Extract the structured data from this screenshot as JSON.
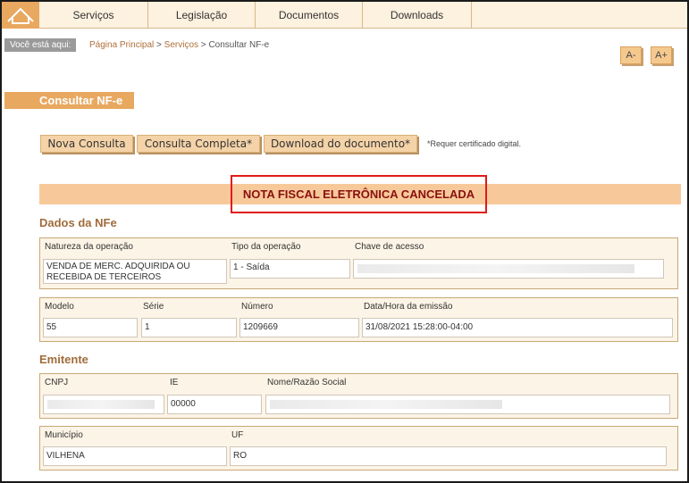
{
  "nav": {
    "items": [
      "Serviços",
      "Legislação",
      "Documentos",
      "Downloads"
    ]
  },
  "breadcrumb": {
    "label": "Você está aqui:",
    "home": "Página Principal",
    "sep1": " > ",
    "services": "Serviços",
    "sep2": " > ",
    "current": "Consultar NF-e"
  },
  "font_controls": {
    "decrease": "A-",
    "increase": "A+"
  },
  "page_title": "Consultar NF-e",
  "actions": {
    "new_query": "Nova Consulta",
    "full_query": "Consulta Completa*",
    "download": "Download do documento*",
    "cert_note": "*Requer certificado digital."
  },
  "status": "NOTA FISCAL ELETRÔNICA CANCELADA",
  "nfe": {
    "section_title": "Dados da NFe",
    "operation_label": "Natureza da operação",
    "operation_value": "VENDA DE MERC. ADQUIRIDA OU RECEBIDA DE TERCEIROS",
    "type_label": "Tipo da operação",
    "type_value": "1 - Saída",
    "key_label": "Chave de acesso",
    "model_label": "Modelo",
    "model_value": "55",
    "series_label": "Série",
    "series_value": "1",
    "number_label": "Número",
    "number_value": "1209669",
    "date_label": "Data/Hora da emissão",
    "date_value": "31/08/2021 15:28:00-04:00"
  },
  "issuer": {
    "section_title": "Emitente",
    "cnpj_label": "CNPJ",
    "ie_label": "IE",
    "ie_value": "00000",
    "name_label": "Nome/Razão Social",
    "city_label": "Município",
    "city_value": "VILHENA",
    "uf_label": "UF",
    "uf_value": "RO"
  },
  "colors": {
    "accent": "#e8a860",
    "status_border": "#e01b1b",
    "status_text": "#8a1010",
    "section_title": "#a06c3a",
    "fieldset_bg": "#fcf4e6"
  }
}
